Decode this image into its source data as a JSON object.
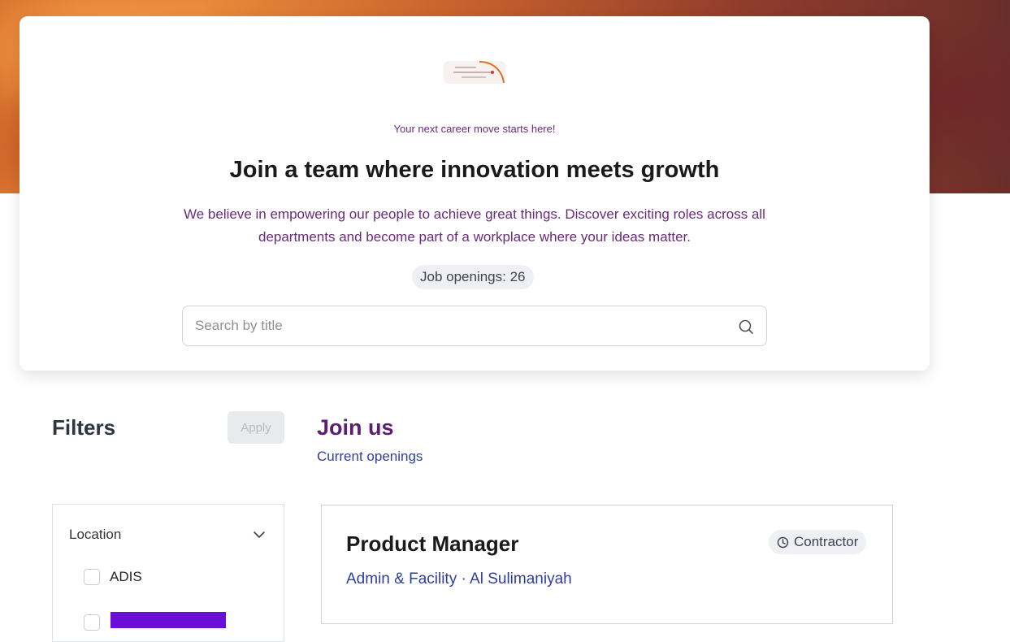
{
  "hero": {
    "tagline": "Your next career move starts here!",
    "headline": "Join a team where innovation meets growth",
    "description": "We believe in empowering our people to achieve great things. Discover exciting roles across all departments and become part of a workplace where your ideas matter.",
    "openings_badge": "Job openings: 26",
    "logo_icon": "company-logo"
  },
  "search": {
    "placeholder": "Search by title",
    "value": "",
    "icon": "search-icon"
  },
  "filters": {
    "title": "Filters",
    "apply_label": "Apply",
    "sections": [
      {
        "heading": "Location",
        "icon": "chevron-down-icon",
        "options": [
          {
            "label": "ADIS",
            "checked": false
          },
          {
            "label": "",
            "checked": false
          }
        ]
      }
    ]
  },
  "main": {
    "title": "Join us",
    "subtitle": "Current openings",
    "jobs": [
      {
        "title": "Product Manager",
        "meta": "Admin & Facility · Al Sulimaniyah",
        "type": "Contractor",
        "type_icon": "clock-icon"
      }
    ]
  },
  "colors": {
    "accent_purple": "#5b1f6e",
    "link_blue": "#2f3f9a",
    "badge_bg": "#eef0f3"
  }
}
